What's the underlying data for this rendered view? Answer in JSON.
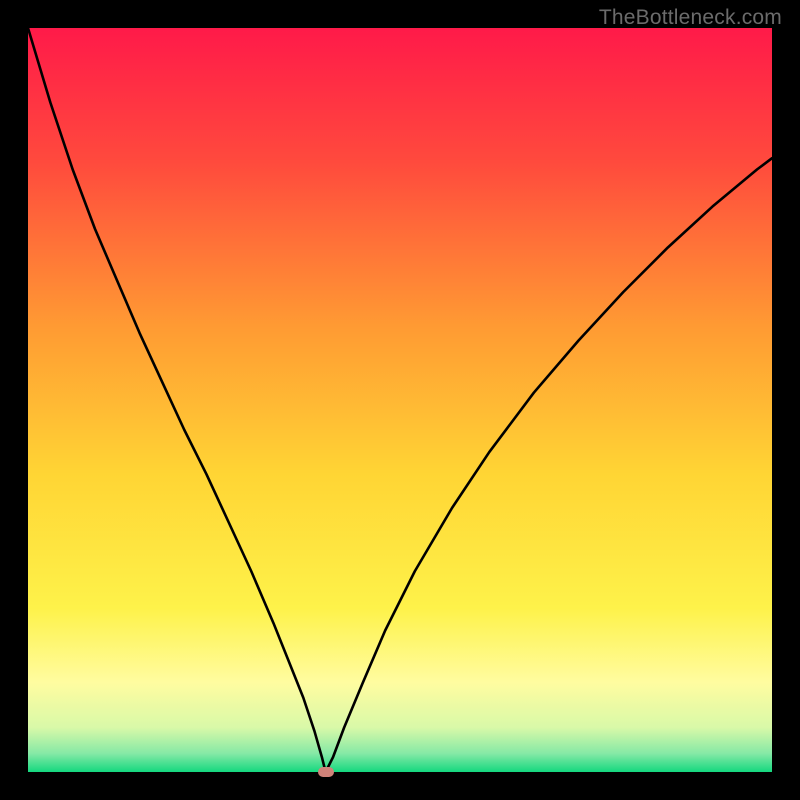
{
  "watermark": {
    "text": "TheBottleneck.com"
  },
  "gradient": {
    "stops": [
      {
        "offset": 0.0,
        "color": "#ff1a49"
      },
      {
        "offset": 0.18,
        "color": "#ff4a3d"
      },
      {
        "offset": 0.4,
        "color": "#ff9a33"
      },
      {
        "offset": 0.6,
        "color": "#ffd534"
      },
      {
        "offset": 0.78,
        "color": "#fef24a"
      },
      {
        "offset": 0.88,
        "color": "#fffca0"
      },
      {
        "offset": 0.94,
        "color": "#d9f9a8"
      },
      {
        "offset": 0.975,
        "color": "#86e9a6"
      },
      {
        "offset": 1.0,
        "color": "#14d87f"
      }
    ]
  },
  "chart_data": {
    "type": "line",
    "title": "",
    "xlabel": "",
    "ylabel": "",
    "xlim": [
      0,
      100
    ],
    "ylim": [
      0,
      100
    ],
    "grid": false,
    "marker": {
      "x": 40.0,
      "y": 0.0,
      "color": "#cf8279"
    },
    "series": [
      {
        "name": "curve",
        "x": [
          0,
          3,
          6,
          9,
          12,
          15,
          18,
          21,
          24,
          27,
          30,
          33,
          35,
          37,
          38.5,
          39.5,
          40,
          41,
          42.5,
          45,
          48,
          52,
          57,
          62,
          68,
          74,
          80,
          86,
          92,
          98,
          100
        ],
        "y": [
          100,
          90,
          81,
          73,
          66,
          59,
          52.5,
          46,
          40,
          33.5,
          27,
          20,
          15,
          10,
          5.5,
          2,
          0,
          2,
          6,
          12,
          19,
          27,
          35.5,
          43,
          51,
          58,
          64.5,
          70.5,
          76,
          81,
          82.5
        ]
      }
    ]
  }
}
